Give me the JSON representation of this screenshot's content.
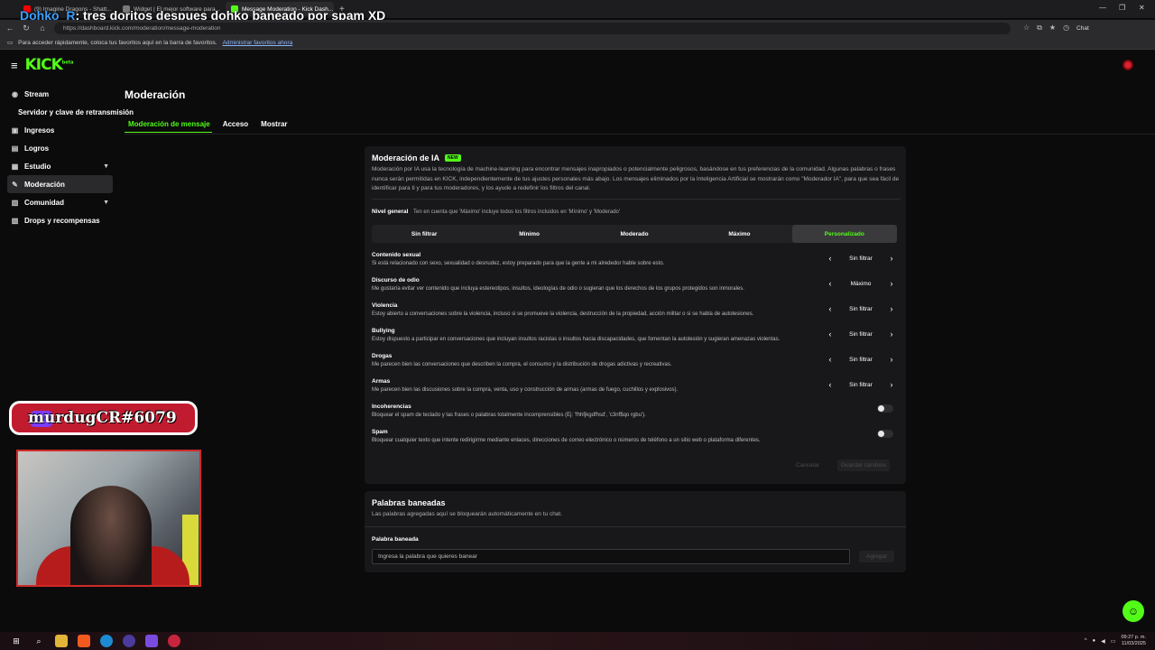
{
  "overlay": {
    "nick": "Dohko_R",
    "message": ": tres doritos despues dohko baneado por spam XD"
  },
  "tabs": [
    {
      "label": "(9) Imagine Dragons - Shatt...",
      "color": "#ff0000"
    },
    {
      "label": "Widget | El mejor software para...",
      "color": "#7a7a7a"
    },
    {
      "label": "Message Moderation - Kick Dash...",
      "color": "#53fc18"
    }
  ],
  "window": {
    "min": "—",
    "max": "❐",
    "close": "✕"
  },
  "address": {
    "url": "https://dashboard.kick.com/moderation/message-moderation",
    "chat_label": "Chat"
  },
  "bookmarks_bar": {
    "text": "Para acceder rápidamente, coloca tus favoritos aquí en la barra de favoritos.",
    "link": "Administrar favoritos ahora"
  },
  "brand": {
    "logo": "KICK",
    "beta": "beta"
  },
  "sidebar": {
    "items": [
      {
        "label": "Stream",
        "icon": "broadcast-icon"
      },
      {
        "label": "Servidor y clave de retransmisión"
      },
      {
        "label": "Ingresos",
        "icon": "money-icon"
      },
      {
        "label": "Logros",
        "icon": "trophy-icon"
      },
      {
        "label": "Estudio",
        "icon": "studio-icon"
      },
      {
        "label": "Moderación",
        "icon": "wrench-icon"
      },
      {
        "label": "Comunidad",
        "icon": "community-icon"
      },
      {
        "label": "Drops y recompensas",
        "icon": "gift-icon"
      }
    ]
  },
  "page": {
    "title": "Moderación",
    "tabs": [
      "Moderación de mensaje",
      "Acceso",
      "Mostrar"
    ]
  },
  "ai": {
    "title": "Moderación de IA",
    "badge": "NEW",
    "description": "Moderación por IA usa la tecnología de machine-learning para encontrar mensajes inapropiados o potencialmente peligrosos, basándose en tus preferencias de la comunidad. Algunas palabras o frases nunca serán permitidas en KICK, independientemente de tus ajustes personales más abajo. Los mensajes eliminados por la Inteligencia Artificial se mostrarán como \"Moderador IA\", para que sea fácil de identificar para ti y para tus moderadores, y los ayude a redefinir los filtros del canal.",
    "level_label": "Nivel general",
    "level_hint": "Ten en cuenta que 'Máximo' incluye todos los filtros incluidos en 'Mínimo' y 'Moderado'",
    "levels": [
      "Sin filtrar",
      "Mínimo",
      "Moderado",
      "Máximo",
      "Personalizado"
    ],
    "selected_level": "Personalizado",
    "categories": [
      {
        "name": "Contenido sexual",
        "desc": "Si está relacionado con sexo, sexualidad o desnudez, estoy preparado para que la gente a mi alrededor hable sobre esto.",
        "value": "Sin filtrar"
      },
      {
        "name": "Discurso de odio",
        "desc": "Me gustaría evitar ver contenido que incluya estereotipos, insultos, ideologías de odio o sugieran que los derechos de los grupos protegidos son inmorales.",
        "value": "Máximo"
      },
      {
        "name": "Violencia",
        "desc": "Estoy abierto a conversaciones sobre la violencia, incluso si se promueve la violencia, destrucción de la propiedad, acción militar o si se habla de autolesiones.",
        "value": "Sin filtrar"
      },
      {
        "name": "Bullying",
        "desc": "Estoy dispuesto a participar en conversaciones que incluyan insultos racistas o insultos hacia discapacidades, que fomentan la autolesión y sugieran amenazas violentas.",
        "value": "Sin filtrar"
      },
      {
        "name": "Drogas",
        "desc": "Me parecen bien las conversaciones que describen la compra, el consumo y la distribución de drogas adictivas y recreativas.",
        "value": "Sin filtrar"
      },
      {
        "name": "Armas",
        "desc": "Me parecen bien las discusiones sobre la compra, venta, uso y construcción de armas (armas de fuego, cuchillos y explosivos).",
        "value": "Sin filtrar"
      }
    ],
    "toggles": [
      {
        "name": "Incoherencias",
        "desc": "Bloquear el spam de teclado y las frases o palabras totalmente incomprensibles (Ej: 'fhhfjkgdfhsd', 'c3nf$qo rgbu')."
      },
      {
        "name": "Spam",
        "desc": "Bloquear cualquier texto que intente redirigirme mediante enlaces, direcciones de correo electrónico o números de teléfono a un sitio web o plataforma diferentes."
      }
    ],
    "cancel": "Cancelar",
    "save": "Guardar cambios"
  },
  "banned": {
    "title": "Palabras baneadas",
    "desc": "Las palabras agregadas aquí se bloquearán automáticamente en tu chat.",
    "field_label": "Palabra baneada",
    "placeholder": "Ingresa la palabra que quieres banear",
    "add": "Agregar"
  },
  "stream_overlay": {
    "discord_tag": "murdugCR#6079"
  },
  "taskbar": {
    "time": "09:27 p. m.",
    "date": "11/03/2025"
  }
}
